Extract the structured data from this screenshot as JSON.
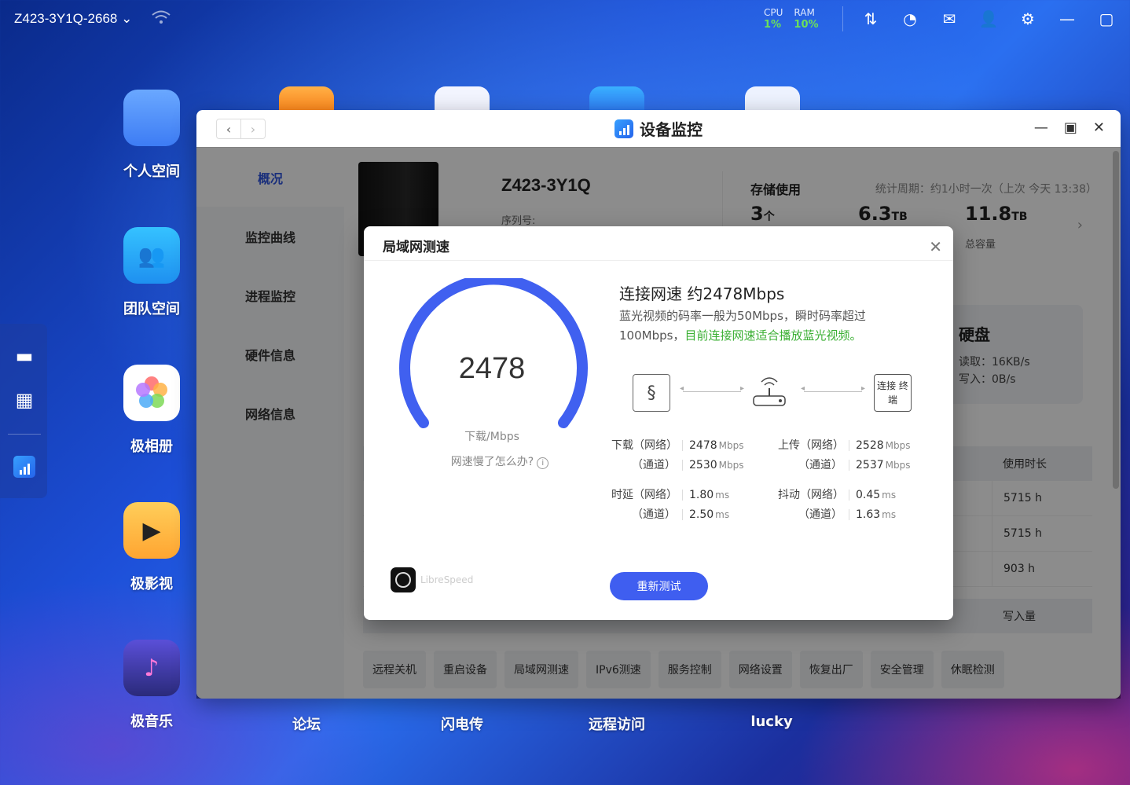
{
  "topbar": {
    "hostname": "Z423-3Y1Q-2668 ⌄",
    "cpu_label": "CPU",
    "cpu_value": "1%",
    "ram_label": "RAM",
    "ram_value": "10%"
  },
  "desktop": {
    "icons": [
      {
        "label": "个人空间"
      },
      {
        "label": "团队空间"
      },
      {
        "label": "极相册"
      },
      {
        "label": "极影视"
      },
      {
        "label": "极音乐"
      }
    ],
    "bottom_labels": [
      "论坛",
      "闪电传",
      "远程访问",
      "lucky"
    ]
  },
  "window": {
    "title": "设备监控",
    "nav": [
      "概况",
      "监控曲线",
      "进程监控",
      "硬件信息",
      "网络信息"
    ],
    "device_name": "Z423-3Y1Q",
    "serial_label": "序列号:",
    "storage": {
      "title": "存储使用",
      "period": "统计周期：约1小时一次（上次 今天 13:38）",
      "count_value": "3",
      "count_unit": "个",
      "used_value": "6.3",
      "used_unit": "TB",
      "total_value": "11.8",
      "total_unit": "TB",
      "total_label": "总容量"
    },
    "disk": {
      "title": "硬盘",
      "read": "读取：16KB/s",
      "write": "写入：0B/s"
    },
    "table": {
      "header": "使用时长",
      "rows": [
        "5715 h",
        "5715 h",
        "903 h"
      ],
      "header2": "写入量"
    },
    "actions": [
      "远程关机",
      "重启设备",
      "局域网测速",
      "IPv6测速",
      "服务控制",
      "网络设置",
      "恢复出厂",
      "安全管理",
      "休眠检测"
    ]
  },
  "modal": {
    "title": "局域网测速",
    "gauge_value": "2478",
    "gauge_unit": "下载/Mbps",
    "slow_link": "网速慢了怎么办?",
    "connection": "连接网速 约2478Mbps",
    "desc_main": "蓝光视频的码率一般为50Mbps，瞬时码率超过100Mbps，",
    "desc_ok": "目前连接网速适合播放蓝光视频。",
    "terminal": "连接 终端",
    "metrics": {
      "download_label": "下载（网络）",
      "download_net": "2478",
      "download_ch_label": "（通道）",
      "download_ch": "2530",
      "upload_label": "上传（网络）",
      "upload_net": "2528",
      "upload_ch_label": "（通道）",
      "upload_ch": "2537",
      "latency_label": "时延（网络）",
      "latency_net": "1.80",
      "latency_ch_label": "（通道）",
      "latency_ch": "2.50",
      "jitter_label": "抖动（网络）",
      "jitter_net": "0.45",
      "jitter_ch_label": "（通道）",
      "jitter_ch": "1.63",
      "mbps": "Mbps",
      "ms": "ms"
    },
    "gauge_fraction": 0.85,
    "libre": "LibreSpeed",
    "retest": "重新测试"
  }
}
